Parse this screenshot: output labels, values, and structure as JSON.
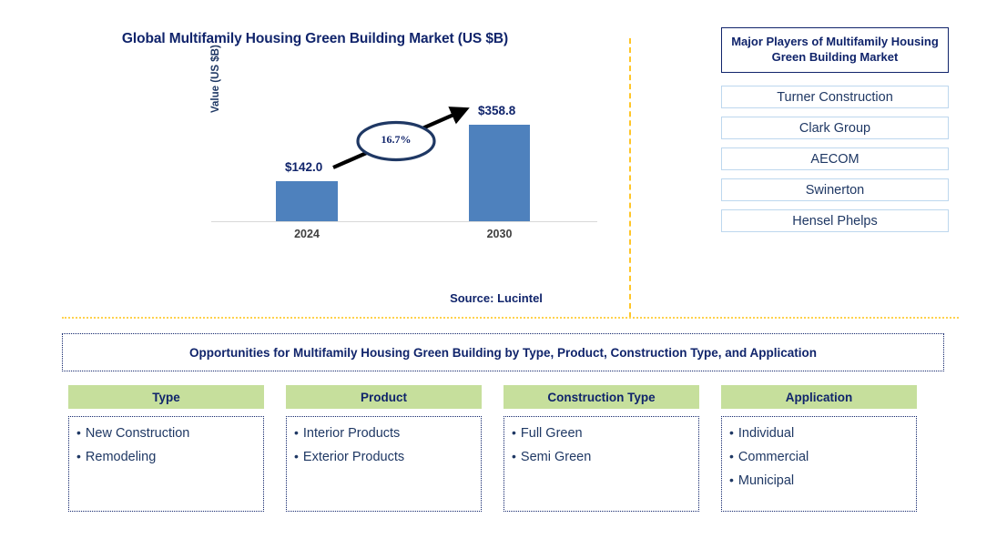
{
  "chart": {
    "title": "Global Multifamily Housing Green Building Market (US $B)",
    "y_axis_label": "Value (US $B)",
    "cagr_label": "16.7%",
    "source": "Source: Lucintel"
  },
  "chart_data": {
    "type": "bar",
    "title": "Global Multifamily Housing Green Building Market (US $B)",
    "xlabel": "",
    "ylabel": "Value (US $B)",
    "categories": [
      "2024",
      "2030"
    ],
    "values": [
      142.0,
      358.8
    ],
    "value_labels": [
      "$142.0",
      "$358.8"
    ],
    "ylim": [
      0,
      400
    ],
    "grid": false,
    "legend": "none",
    "annotations": [
      {
        "text": "16.7%",
        "type": "cagr-callout",
        "from": "2024",
        "to": "2030"
      }
    ],
    "series_color": "#4E81BD"
  },
  "players": {
    "header": "Major Players of Multifamily Housing Green Building Market",
    "items": [
      "Turner Construction",
      "Clark Group",
      "AECOM",
      "Swinerton",
      "Hensel Phelps"
    ]
  },
  "opportunities": {
    "title": "Opportunities for Multifamily Housing Green Building by Type, Product, Construction Type, and Application",
    "columns": [
      {
        "header": "Type",
        "items": [
          "New Construction",
          "Remodeling"
        ]
      },
      {
        "header": "Product",
        "items": [
          "Interior Products",
          "Exterior Products"
        ]
      },
      {
        "header": "Construction Type",
        "items": [
          "Full Green",
          "Semi Green"
        ]
      },
      {
        "header": "Application",
        "items": [
          "Individual",
          "Commercial",
          "Municipal"
        ]
      }
    ]
  },
  "colors": {
    "bar": "#4E81BD",
    "navy": "#10246B",
    "green_header": "#C6DF9C",
    "divider_yellow": "#FFC527",
    "player_border": "#BDD7EE"
  }
}
